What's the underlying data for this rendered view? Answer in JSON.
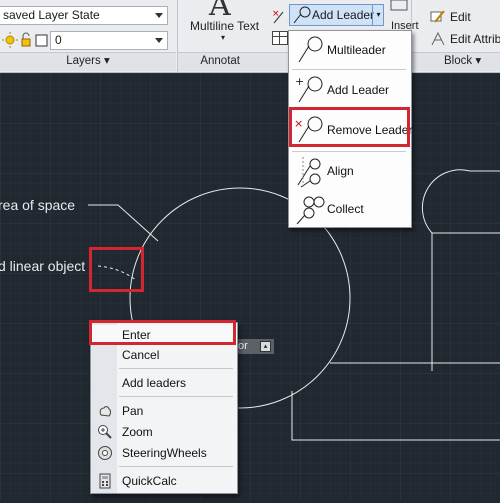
{
  "ribbon": {
    "layer_state": "saved Layer State",
    "layer_current": "0",
    "layers_panel": "Layers",
    "multiline_text": "Multiline Text",
    "annotation_panel": "Annotat",
    "add_leader": "Add Leader",
    "insert": "Insert",
    "edit": "Edit",
    "edit_attrib": "Edit Attribu",
    "block_panel": "Block"
  },
  "leader_menu": {
    "items": [
      {
        "label": "Multileader",
        "icon": "multileader-icon"
      },
      {
        "label": "Add Leader",
        "icon": "add-leader-icon"
      },
      {
        "label": "Remove Leader",
        "icon": "remove-leader-icon",
        "highlighted": true
      },
      {
        "label": "Align",
        "icon": "align-leaders-icon"
      },
      {
        "label": "Collect",
        "icon": "collect-leaders-icon"
      }
    ]
  },
  "canvas": {
    "label_area": "rea of space",
    "label_linear": "d linear object",
    "tooltip_fragment": "or"
  },
  "context_menu": {
    "items": [
      {
        "label": "Enter",
        "highlighted": true
      },
      {
        "label": "Cancel"
      },
      {
        "label": "Add leaders"
      },
      {
        "label": "Pan",
        "icon": "pan-icon"
      },
      {
        "label": "Zoom",
        "icon": "zoom-icon"
      },
      {
        "label": "SteeringWheels",
        "icon": "steeringwheels-icon"
      },
      {
        "label": "QuickCalc",
        "icon": "quickcalc-icon"
      }
    ]
  },
  "colors": {
    "canvas_bg": "#212830",
    "grid": "#2c343d",
    "highlight": "#d22630",
    "geometry": "#e8eaec"
  }
}
